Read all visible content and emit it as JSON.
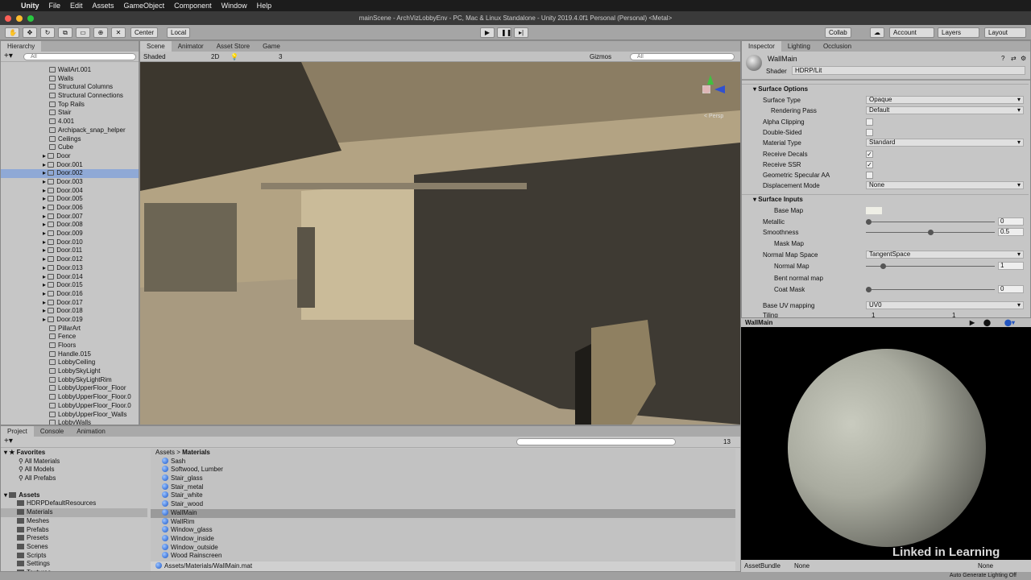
{
  "menubar": {
    "app": "Unity",
    "items": [
      "File",
      "Edit",
      "Assets",
      "GameObject",
      "Component",
      "Window",
      "Help"
    ]
  },
  "window_title": "mainScene - ArchVizLobbyEnv - PC, Mac & Linux Standalone - Unity 2019.4.0f1 Personal (Personal) <Metal>",
  "toolbar": {
    "pivot": "Center",
    "space": "Local",
    "collab": "Collab",
    "account": "Account",
    "layers": "Layers",
    "layout": "Layout"
  },
  "hierarchy": {
    "tab": "Hierarchy",
    "search_placeholder": "All",
    "selected": "Door.002",
    "items": [
      "WallArt.001",
      "Walls",
      "Structural Columns",
      "Structural Connections",
      "Top Rails",
      "Stair",
      "4.001",
      "Archipack_snap_helper",
      "Ceilings",
      "Cube",
      "Door",
      "Door.001",
      "Door.002",
      "Door.003",
      "Door.004",
      "Door.005",
      "Door.006",
      "Door.007",
      "Door.008",
      "Door.009",
      "Door.010",
      "Door.011",
      "Door.012",
      "Door.013",
      "Door.014",
      "Door.015",
      "Door.016",
      "Door.017",
      "Door.018",
      "Door.019",
      "PillarArt",
      "Fence",
      "Floors",
      "Handle.015",
      "LobbyCeiling",
      "LobbySkyLight",
      "LobbySkyLightRim",
      "LobbyUpperFloor_Floor",
      "LobbyUpperFloor_Floor.0",
      "LobbyUpperFloor_Floor.0",
      "LobbyUpperFloor_Walls",
      "LobbyWalls"
    ]
  },
  "scene": {
    "tabs": [
      "Scene",
      "Animator",
      "Asset Store",
      "Game"
    ],
    "shading": "Shaded",
    "mode2d": "2D",
    "layers_count": "3",
    "gizmos": "Gizmos",
    "search_placeholder": "All",
    "projection": "< Persp"
  },
  "inspector": {
    "tabs": [
      "Inspector",
      "Lighting",
      "Occlusion"
    ],
    "material": "WallMain",
    "shader_label": "Shader",
    "shader": "HDRP/Lit",
    "surface_options": {
      "title": "Surface Options",
      "rows": [
        {
          "label": "Surface Type",
          "type": "dropdown",
          "value": "Opaque"
        },
        {
          "label": "Rendering Pass",
          "type": "dropdown",
          "value": "Default",
          "indent": true
        },
        {
          "label": "Alpha Clipping",
          "type": "checkbox",
          "checked": false
        },
        {
          "label": "Double-Sided",
          "type": "checkbox",
          "checked": false
        },
        {
          "label": "Material Type",
          "type": "dropdown",
          "value": "Standard"
        },
        {
          "label": "Receive Decals",
          "type": "checkbox",
          "checked": true
        },
        {
          "label": "Receive SSR",
          "type": "checkbox",
          "checked": true
        },
        {
          "label": "Geometric Specular AA",
          "type": "checkbox",
          "checked": false
        },
        {
          "label": "Displacement Mode",
          "type": "dropdown",
          "value": "None"
        }
      ]
    },
    "surface_inputs": {
      "title": "Surface Inputs",
      "base_map": "Base Map",
      "metallic_label": "Metallic",
      "metallic": "0",
      "smoothness_label": "Smoothness",
      "smoothness": "0.5",
      "mask_map": "Mask Map",
      "normal_space_label": "Normal Map Space",
      "normal_space": "TangentSpace",
      "normal_map": "Normal Map",
      "normal_scale": "1",
      "bent_normal": "Bent normal map",
      "coat_mask": "Coat Mask",
      "coat_value": "0",
      "uv_label": "Base UV mapping",
      "uv": "UV0",
      "tiling_label": "Tiling",
      "tiling_x": "1",
      "tiling_y": "1"
    },
    "preview_title": "WallMain",
    "assetbundle_label": "AssetBundle",
    "assetbundle": "None",
    "assetbundle_variant": "None"
  },
  "project": {
    "tabs": [
      "Project",
      "Console",
      "Animation"
    ],
    "favorites": "Favorites",
    "fav_items": [
      "All Materials",
      "All Models",
      "All Prefabs"
    ],
    "assets": "Assets",
    "folders": [
      "HDRPDefaultResources",
      "Materials",
      "Meshes",
      "Prefabs",
      "Presets",
      "Scenes",
      "Scripts",
      "Settings",
      "Textures"
    ],
    "selected_folder": "Materials",
    "breadcrumb": [
      "Assets",
      "Materials"
    ],
    "files": [
      "Sash",
      "Softwood, Lumber",
      "Stair_glass",
      "Stair_metal",
      "Stair_white",
      "Stair_wood",
      "WallMain",
      "WallRim",
      "Window_glass",
      "Window_inside",
      "Window_outside",
      "Wood Rainscreen"
    ],
    "selected_file": "WallMain",
    "path": "Assets/Materials/WallMain.mat",
    "count": "13"
  },
  "status": "Auto Generate Lighting Off",
  "watermark": "Linked in Learning",
  "colors": {
    "selection": "#8fa9d6",
    "panel": "#c6c6c6",
    "menubar": "#1c1c1c"
  }
}
